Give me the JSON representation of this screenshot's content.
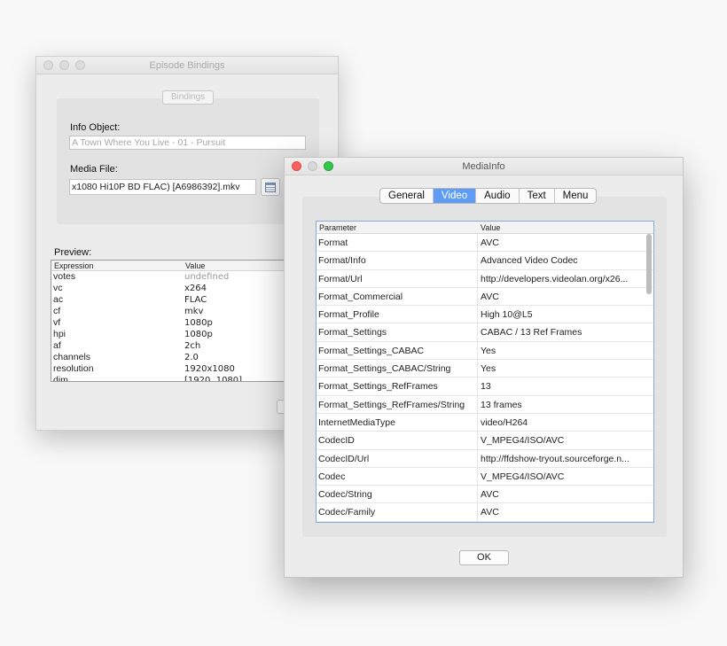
{
  "bindings_window": {
    "title": "Episode Bindings",
    "bindings_button": "Bindings",
    "info_object_label": "Info Object:",
    "info_object_value": "A Town Where You Live - 01 - Pursuit",
    "media_file_label": "Media File:",
    "media_file_value": "x1080 Hi10P BD FLAC) [A6986392].mkv",
    "preview_label": "Preview:",
    "preview_columns": [
      "Expression",
      "Value"
    ],
    "preview_rows": [
      {
        "k": "votes",
        "v": "undefined"
      },
      {
        "k": "vc",
        "v": "x264"
      },
      {
        "k": "ac",
        "v": "FLAC"
      },
      {
        "k": "cf",
        "v": "mkv"
      },
      {
        "k": "vf",
        "v": "1080p"
      },
      {
        "k": "hpi",
        "v": "1080p"
      },
      {
        "k": "af",
        "v": "2ch"
      },
      {
        "k": "channels",
        "v": "2.0"
      },
      {
        "k": "resolution",
        "v": "1920x1080"
      },
      {
        "k": "dim",
        "v": "[1920, 1080]"
      }
    ]
  },
  "mediainfo_window": {
    "title": "MediaInfo",
    "tabs": [
      {
        "label": "General",
        "active": false
      },
      {
        "label": "Video",
        "active": true
      },
      {
        "label": "Audio",
        "active": false
      },
      {
        "label": "Text",
        "active": false
      },
      {
        "label": "Menu",
        "active": false
      }
    ],
    "columns": [
      "Parameter",
      "Value"
    ],
    "rows": [
      {
        "p": "Format",
        "v": "AVC"
      },
      {
        "p": "Format/Info",
        "v": "Advanced Video Codec"
      },
      {
        "p": "Format/Url",
        "v": "http://developers.videolan.org/x26..."
      },
      {
        "p": "Format_Commercial",
        "v": "AVC"
      },
      {
        "p": "Format_Profile",
        "v": "High 10@L5"
      },
      {
        "p": "Format_Settings",
        "v": "CABAC / 13 Ref Frames"
      },
      {
        "p": "Format_Settings_CABAC",
        "v": "Yes"
      },
      {
        "p": "Format_Settings_CABAC/String",
        "v": "Yes"
      },
      {
        "p": "Format_Settings_RefFrames",
        "v": "13"
      },
      {
        "p": "Format_Settings_RefFrames/String",
        "v": "13 frames"
      },
      {
        "p": "InternetMediaType",
        "v": "video/H264"
      },
      {
        "p": "CodecID",
        "v": "V_MPEG4/ISO/AVC"
      },
      {
        "p": "CodecID/Url",
        "v": "http://ffdshow-tryout.sourceforge.n..."
      },
      {
        "p": "Codec",
        "v": "V_MPEG4/ISO/AVC"
      },
      {
        "p": "Codec/String",
        "v": "AVC"
      },
      {
        "p": "Codec/Family",
        "v": "AVC"
      }
    ],
    "ok_button": "OK"
  },
  "colors": {
    "tab_active": "#5f9cf4",
    "close_red": "#fc605c",
    "zoom_green": "#34c84a"
  }
}
